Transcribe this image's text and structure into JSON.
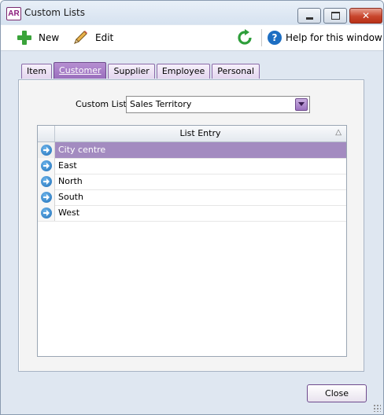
{
  "window": {
    "app_icon_text": "AR",
    "title": "Custom Lists",
    "close_glyph": "✕"
  },
  "toolbar": {
    "new_label": "New",
    "edit_label": "Edit",
    "help_label": "Help for this window"
  },
  "tabs": [
    {
      "label": "Item",
      "active": false
    },
    {
      "label": "Customer",
      "active": true
    },
    {
      "label": "Supplier",
      "active": false
    },
    {
      "label": "Employee",
      "active": false
    },
    {
      "label": "Personal",
      "active": false
    }
  ],
  "custom_list": {
    "label": "Custom List:",
    "value": "Sales Territory"
  },
  "grid": {
    "column_header": "List Entry",
    "rows": [
      "City centre",
      "East",
      "North",
      "South",
      "West"
    ],
    "selected_index": 0
  },
  "footer": {
    "close_label": "Close"
  },
  "colors": {
    "accent_purple": "#a38bc0",
    "tab_active": "#9a6fbe",
    "help_blue": "#1d6ec2",
    "refresh_green": "#2e9e3a"
  },
  "icons": [
    "plus-icon",
    "pencil-icon",
    "refresh-icon",
    "help-icon",
    "arrow-right-icon",
    "dropdown-arrow-icon"
  ]
}
